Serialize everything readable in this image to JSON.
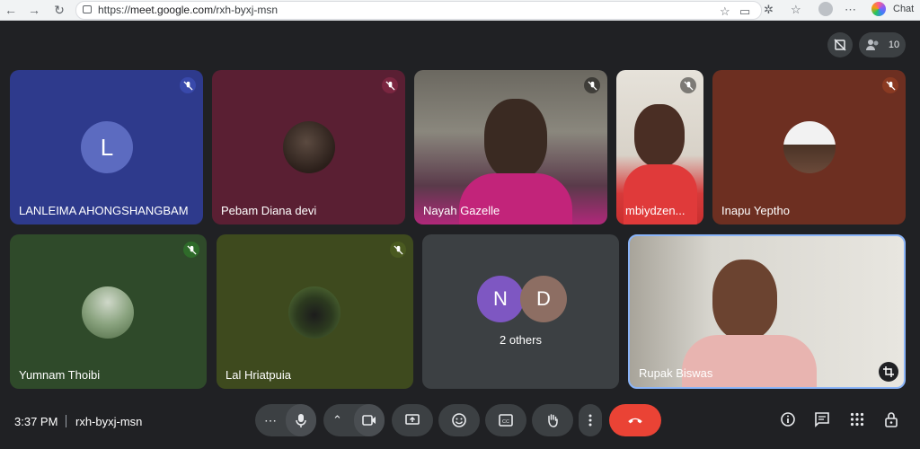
{
  "browser": {
    "url_scheme": "https://",
    "url_host": "meet.google.com",
    "url_path": "/rxh-byxj-msn",
    "chat_label": "Chat"
  },
  "meeting": {
    "participant_count": "10",
    "time": "3:37 PM",
    "code": "rxh-byxj-msn"
  },
  "tiles": [
    {
      "name": "LANLEIMA AHONGSHANGBAM",
      "avatar_letter": "L",
      "bg": "#2e3a8c",
      "avatar_color": "#5c6bc0",
      "muted": true
    },
    {
      "name": "Pebam Diana devi",
      "bg": "#5a1f33",
      "muted": true
    },
    {
      "name": "Nayah Gazelle",
      "bg": "#5e5a52",
      "muted": true
    },
    {
      "name": "mbiydzen...",
      "bg": "#d9d5cc",
      "muted": true
    },
    {
      "name": "Inapu Yeptho",
      "bg": "#6d2f21",
      "muted": true
    },
    {
      "name": "Yumnam Thoibi",
      "bg": "#2f4a2a",
      "muted": true
    },
    {
      "name": "Lal Hriatpuia",
      "bg": "#3e4a1e",
      "muted": true
    },
    {
      "name": "Rupak Biswas",
      "bg": "#cfcdc6"
    }
  ],
  "others": {
    "label": "2 others",
    "avatars": [
      {
        "letter": "N",
        "color": "#7e57c2"
      },
      {
        "letter": "D",
        "color": "#8d6e63"
      }
    ]
  },
  "colors": {
    "end_call": "#ea4335",
    "control_bg": "#3c4043",
    "stage_bg": "#202124"
  }
}
